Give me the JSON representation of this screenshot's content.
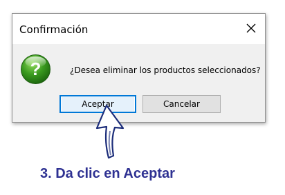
{
  "dialog": {
    "title": "Confirmación",
    "message": "¿Desea eliminar los productos seleccionados?",
    "icon": "question-icon",
    "buttons": {
      "ok_label": "Aceptar",
      "cancel_label": "Cancelar"
    }
  },
  "annotation": {
    "instruction": "3. Da clic en Aceptar",
    "arrow": "up-arrow-icon"
  },
  "colors": {
    "instruction_text": "#2e3192",
    "focus_border": "#0078d7",
    "icon_green": "#3a9a1f"
  }
}
